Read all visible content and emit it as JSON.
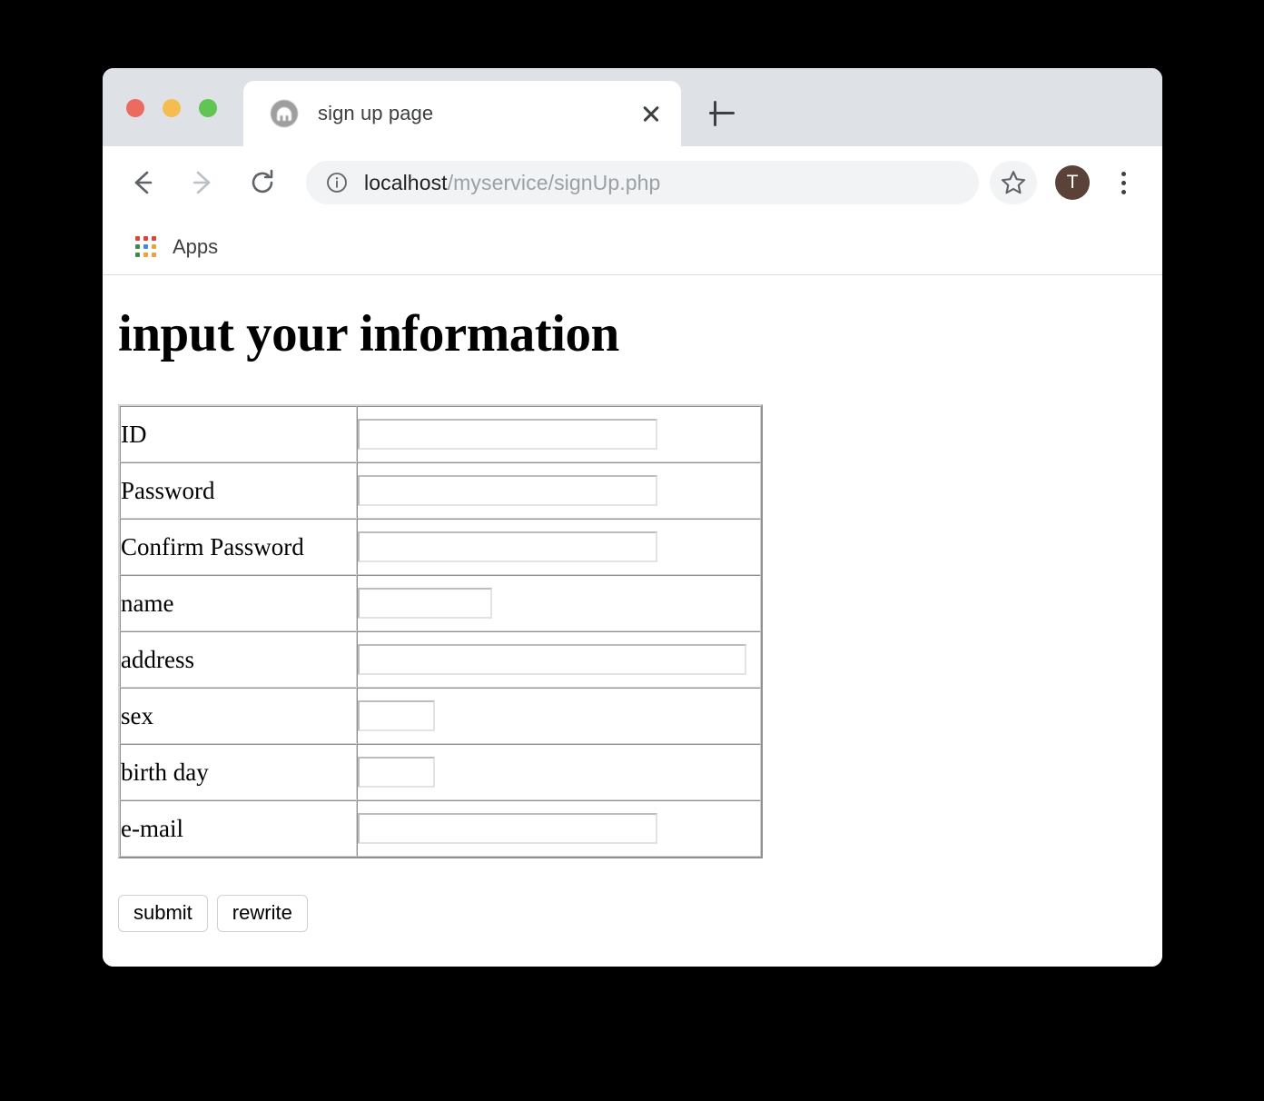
{
  "browser": {
    "tab": {
      "title": "sign up page",
      "favicon": "globe-favicon",
      "close_label": "×"
    },
    "new_tab_label": "+",
    "toolbar": {
      "back_label": "Back",
      "forward_label": "Forward",
      "reload_label": "Reload",
      "url_host": "localhost",
      "url_path": "/myservice/signUp.php",
      "info_label": "Site information",
      "star_label": "Bookmark this tab",
      "avatar_initial": "T",
      "menu_label": "Customize and control"
    },
    "bookmarks": {
      "apps_label": "Apps"
    }
  },
  "page": {
    "heading": "input your information",
    "form_rows": [
      {
        "label": "ID",
        "input_width": "w-long",
        "extra_pad": false
      },
      {
        "label": "Password",
        "input_width": "w-long",
        "extra_pad": false
      },
      {
        "label": "Confirm Password",
        "input_width": "w-long",
        "extra_pad": false
      },
      {
        "label": "name",
        "input_width": "w-med",
        "extra_pad": false
      },
      {
        "label": "address",
        "input_width": "w-xlong",
        "extra_pad": false
      },
      {
        "label": "sex",
        "input_width": "w-short",
        "extra_pad": false
      },
      {
        "label": "birth day",
        "input_width": "w-short",
        "extra_pad": false
      },
      {
        "label": "e-mail",
        "input_width": "w-long",
        "extra_pad": false
      }
    ],
    "buttons": {
      "submit_label": "submit",
      "rewrite_label": "rewrite"
    }
  },
  "colors": {
    "tab_strip_bg": "#DEE1E6",
    "traffic_red": "#EC6A5E",
    "traffic_yellow": "#F5BD4F",
    "traffic_green": "#61C554",
    "avatar_bg": "#5A4238",
    "omnibox_bg": "#F1F3F4",
    "apps_grid": [
      "#DB4437",
      "#DB4437",
      "#DB4437",
      "#3D8C47",
      "#4285F4",
      "#EFA23C",
      "#3D8C47",
      "#EFA23C",
      "#EFA23C"
    ]
  }
}
